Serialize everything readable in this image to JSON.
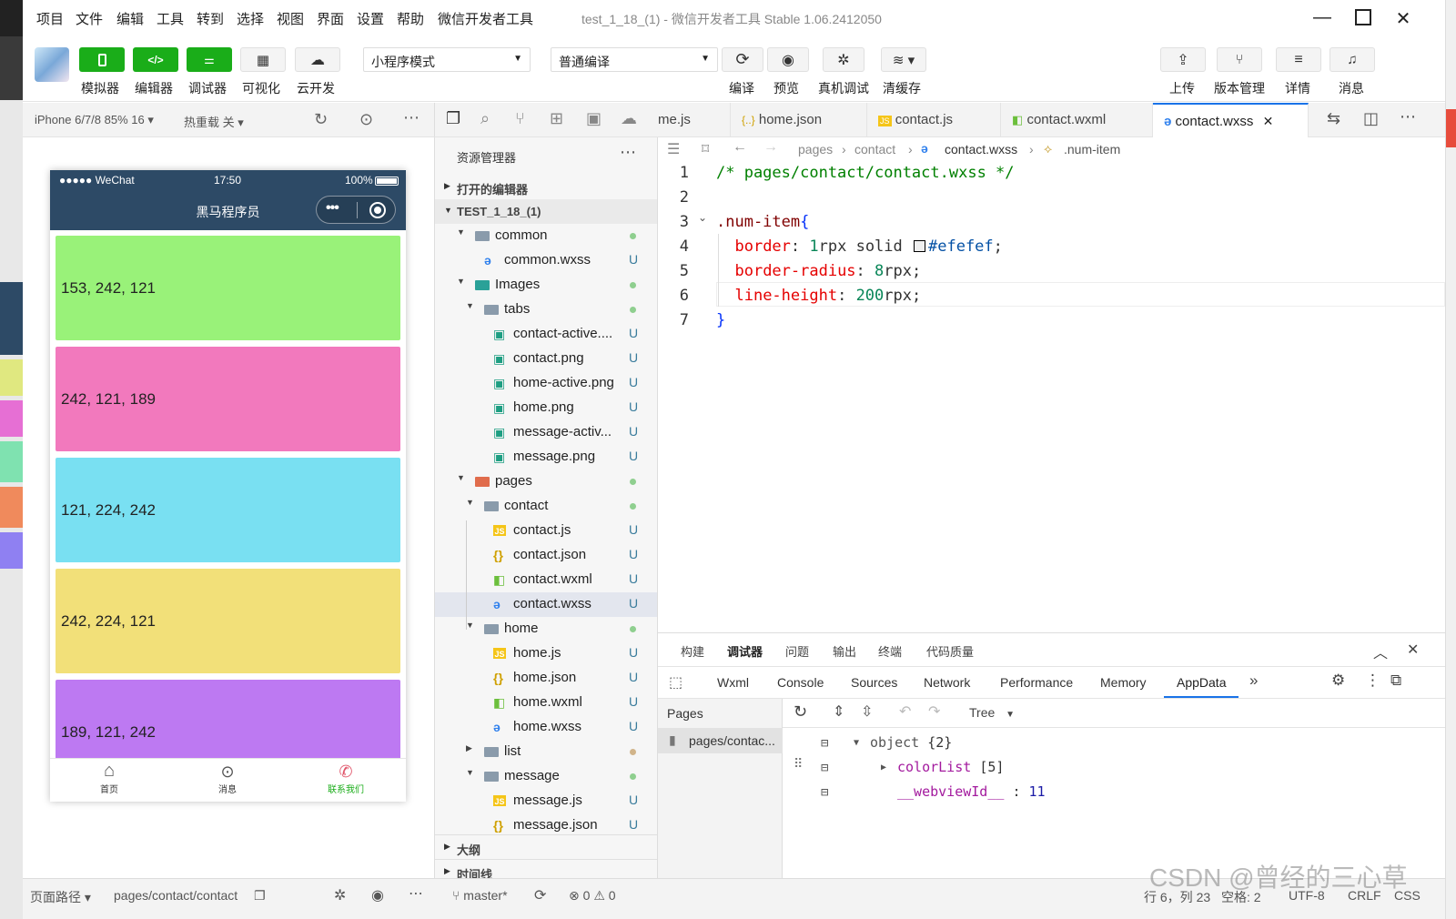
{
  "menu": [
    "项目",
    "文件",
    "编辑",
    "工具",
    "转到",
    "选择",
    "视图",
    "界面",
    "设置",
    "帮助",
    "微信开发者工具"
  ],
  "window_title": "test_1_18_(1) - 微信开发者工具 Stable 1.06.2412050",
  "toolbar": {
    "buttons": [
      "模拟器",
      "编辑器",
      "调试器",
      "可视化",
      "云开发"
    ],
    "mode_select": "小程序模式",
    "compile_select": "普通编译",
    "actions": [
      "编译",
      "预览",
      "真机调试",
      "清缓存"
    ],
    "right_actions": [
      "上传",
      "版本管理",
      "详情",
      "消息"
    ]
  },
  "simbar": {
    "device": "iPhone 6/7/8 85% 16 ▾",
    "hotreload": "热重载 关 ▾"
  },
  "phone": {
    "status_left": "●●●●● WeChat",
    "time": "17:50",
    "battery": "100%",
    "nav_title": "黑马程序员",
    "boxes": [
      {
        "label": "153, 242, 121",
        "color": "#99f279"
      },
      {
        "label": "242, 121, 189",
        "color": "#f279bd"
      },
      {
        "label": "121, 224, 242",
        "color": "#79e0f2"
      },
      {
        "label": "242, 224, 121",
        "color": "#f2e079"
      },
      {
        "label": "189, 121, 242",
        "color": "#bd79f2"
      }
    ],
    "tabbar": [
      {
        "label": "首页",
        "icon": "home-icon",
        "active": false
      },
      {
        "label": "消息",
        "icon": "message-icon",
        "active": false
      },
      {
        "label": "联系我们",
        "icon": "contact-icon",
        "active": true
      }
    ],
    "tab_active_color": "#1aad19"
  },
  "explorer": {
    "title": "资源管理器",
    "sections": [
      "打开的编辑器",
      "TEST_1_18_(1)",
      "大纲",
      "时间线"
    ],
    "tree": [
      {
        "name": "common",
        "type": "folder",
        "depth": 1,
        "open": true,
        "status": "dot"
      },
      {
        "name": "common.wxss",
        "type": "wxss",
        "depth": 2,
        "status": "U"
      },
      {
        "name": "Images",
        "type": "folder-img",
        "depth": 1,
        "open": true,
        "status": "dot"
      },
      {
        "name": "tabs",
        "type": "folder",
        "depth": 2,
        "open": true,
        "status": "dot"
      },
      {
        "name": "contact-active....",
        "type": "img",
        "depth": 3,
        "status": "U"
      },
      {
        "name": "contact.png",
        "type": "img",
        "depth": 3,
        "status": "U"
      },
      {
        "name": "home-active.png",
        "type": "img",
        "depth": 3,
        "status": "U"
      },
      {
        "name": "home.png",
        "type": "img",
        "depth": 3,
        "status": "U"
      },
      {
        "name": "message-activ...",
        "type": "img",
        "depth": 3,
        "status": "U"
      },
      {
        "name": "message.png",
        "type": "img",
        "depth": 3,
        "status": "U"
      },
      {
        "name": "pages",
        "type": "folder-pages",
        "depth": 1,
        "open": true,
        "status": "dot"
      },
      {
        "name": "contact",
        "type": "folder",
        "depth": 2,
        "open": true,
        "status": "dot"
      },
      {
        "name": "contact.js",
        "type": "js",
        "depth": 3,
        "status": "U"
      },
      {
        "name": "contact.json",
        "type": "json",
        "depth": 3,
        "status": "U"
      },
      {
        "name": "contact.wxml",
        "type": "wxml",
        "depth": 3,
        "status": "U"
      },
      {
        "name": "contact.wxss",
        "type": "wxss",
        "depth": 3,
        "status": "U",
        "selected": true
      },
      {
        "name": "home",
        "type": "folder",
        "depth": 2,
        "open": true,
        "status": "dot"
      },
      {
        "name": "home.js",
        "type": "js",
        "depth": 3,
        "status": "U"
      },
      {
        "name": "home.json",
        "type": "json",
        "depth": 3,
        "status": "U"
      },
      {
        "name": "home.wxml",
        "type": "wxml",
        "depth": 3,
        "status": "U"
      },
      {
        "name": "home.wxss",
        "type": "wxss",
        "depth": 3,
        "status": "U"
      },
      {
        "name": "list",
        "type": "folder",
        "depth": 2,
        "open": false,
        "status": "dot-brown"
      },
      {
        "name": "message",
        "type": "folder",
        "depth": 2,
        "open": true,
        "status": "dot"
      },
      {
        "name": "message.js",
        "type": "js",
        "depth": 3,
        "status": "U"
      },
      {
        "name": "message.json",
        "type": "json",
        "depth": 3,
        "status": "U"
      }
    ]
  },
  "editor": {
    "tabs": [
      {
        "label": "me.js",
        "type": "js"
      },
      {
        "label": "home.json",
        "type": "json"
      },
      {
        "label": "contact.js",
        "type": "js"
      },
      {
        "label": "contact.wxml",
        "type": "wxml"
      },
      {
        "label": "contact.wxss",
        "type": "wxss",
        "active": true
      }
    ],
    "breadcrumb": [
      "pages",
      "contact",
      "contact.wxss",
      ".num-item"
    ],
    "line_numbers": [
      "1",
      "2",
      "3",
      "4",
      "5",
      "6",
      "7"
    ],
    "lines": [
      [
        {
          "t": "/* pages/contact/contact.wxss */",
          "c": "#008000"
        }
      ],
      [],
      [
        {
          "t": ".num-item",
          "c": "#800000"
        },
        {
          "t": "{",
          "c": "#0431fa"
        }
      ],
      [
        {
          "t": "  "
        },
        {
          "t": "border",
          "c": "#e50000"
        },
        {
          "t": ": "
        },
        {
          "t": "1",
          "c": "#098658"
        },
        {
          "t": "rpx solid "
        },
        {
          "t": "swatch"
        },
        {
          "t": "#efefef",
          "c": "#0451a5"
        },
        {
          "t": ";"
        }
      ],
      [
        {
          "t": "  "
        },
        {
          "t": "border-radius",
          "c": "#e50000"
        },
        {
          "t": ": "
        },
        {
          "t": "8",
          "c": "#098658"
        },
        {
          "t": "rpx;"
        }
      ],
      [
        {
          "t": "  "
        },
        {
          "t": "line-height",
          "c": "#e50000"
        },
        {
          "t": ": "
        },
        {
          "t": "200",
          "c": "#098658"
        },
        {
          "t": "rpx;"
        }
      ],
      [
        {
          "t": "}",
          "c": "#0431fa"
        }
      ]
    ]
  },
  "debugger": {
    "top_tabs": [
      "构建",
      "调试器",
      "问题",
      "输出",
      "终端",
      "代码质量"
    ],
    "dev_tabs": [
      "Wxml",
      "Console",
      "Sources",
      "Network",
      "Performance",
      "Memory",
      "AppData"
    ],
    "pages_label": "Pages",
    "page_item": "pages/contac...",
    "view_mode": "Tree",
    "appdata": {
      "root": "object",
      "root_count": "{2}",
      "key1": "colorList",
      "key1_count": "[5]",
      "key2": "__webviewId__",
      "key2_value": "11"
    }
  },
  "statusbar": {
    "page_path_label": "页面路径 ▾",
    "page_path": "pages/contact/contact",
    "branch": "master*",
    "errors": "0",
    "warnings": "0",
    "cursor": "行 6，列 23",
    "spaces": "空格: 2",
    "encoding": "UTF-8",
    "eol": "CRLF",
    "lang": "CSS"
  },
  "watermark": "CSDN @曾经的三心草"
}
